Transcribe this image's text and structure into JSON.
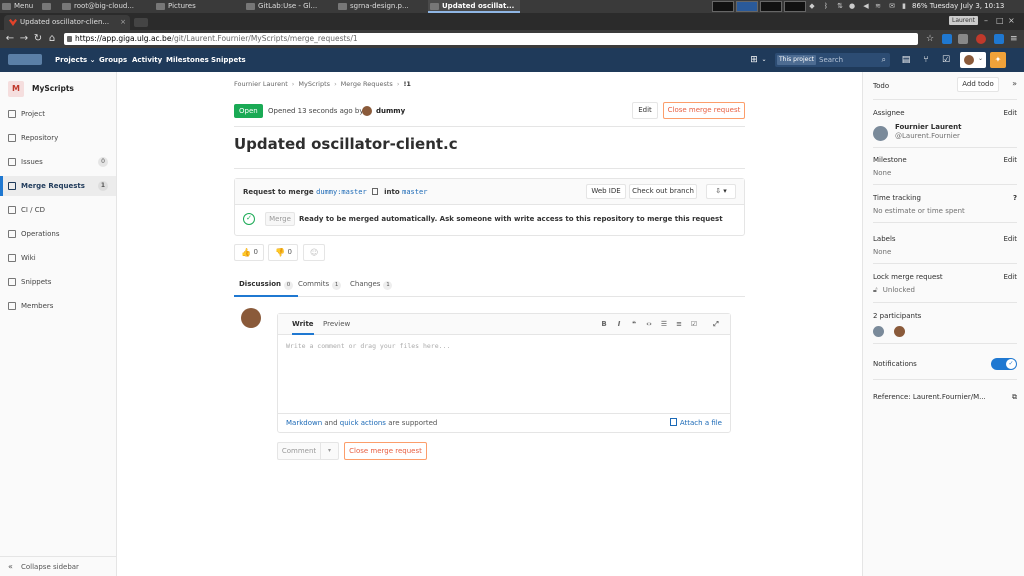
{
  "taskbar": {
    "items": [
      {
        "label": "Menu"
      },
      {
        "label": "root@big-cloud..."
      },
      {
        "label": "Pictures"
      },
      {
        "label": "GitLab:Use - Gl..."
      },
      {
        "label": "sgrna-design.p..."
      },
      {
        "label": "Updated oscillat..."
      }
    ],
    "battery": "86%",
    "datetime": "Tuesday July  3, 10:13"
  },
  "browser": {
    "tab_title": "Updated oscillator-clien...",
    "tab_close": "×",
    "window_badge": "Laurent",
    "url_host": "https://app.giga.ulg.ac.be",
    "url_path": "/git/Laurent.Fournier/MyScripts/merge_requests/1"
  },
  "header": {
    "nav": [
      "Projects",
      "Groups",
      "Activity",
      "Milestones",
      "Snippets"
    ],
    "search_scope": "This project",
    "search_placeholder": "Search"
  },
  "sidebar": {
    "project_initial": "M",
    "project_name": "MyScripts",
    "items": [
      {
        "label": "Project"
      },
      {
        "label": "Repository"
      },
      {
        "label": "Issues",
        "count": "0"
      },
      {
        "label": "Merge Requests",
        "count": "1"
      },
      {
        "label": "CI / CD"
      },
      {
        "label": "Operations"
      },
      {
        "label": "Wiki"
      },
      {
        "label": "Snippets"
      },
      {
        "label": "Members"
      }
    ],
    "collapse_label": "Collapse sidebar"
  },
  "breadcrumb": [
    "Fournier Laurent",
    "MyScripts",
    "Merge Requests",
    "!1"
  ],
  "mr": {
    "status": "Open",
    "opened_text": "Opened 13 seconds ago by",
    "author": "dummy",
    "edit_label": "Edit",
    "close_label": "Close merge request",
    "title": "Updated oscillator-client.c",
    "request_prefix": "Request to merge",
    "source_branch": "dummy:master",
    "into": "into",
    "target_branch": "master",
    "web_ide": "Web IDE",
    "checkout": "Check out branch",
    "merge_btn": "Merge",
    "merge_msg": "Ready to be merged automatically. Ask someone with write access to this repository to merge this request",
    "thumbs_up": "0",
    "thumbs_down": "0"
  },
  "tabs": [
    {
      "label": "Discussion",
      "count": "0"
    },
    {
      "label": "Commits",
      "count": "1"
    },
    {
      "label": "Changes",
      "count": "1"
    }
  ],
  "note": {
    "write_tab": "Write",
    "preview_tab": "Preview",
    "placeholder": "Write a comment or drag your files here...",
    "markdown": "Markdown",
    "and": "and",
    "quick_actions": "quick actions",
    "supported": "are supported",
    "attach": "Attach a file",
    "comment_btn": "Comment",
    "close_btn": "Close merge request"
  },
  "right_sidebar": {
    "todo_label": "Todo",
    "add_todo": "Add todo",
    "assignee_label": "Assignee",
    "assignee_name": "Fournier Laurent",
    "assignee_handle": "@Laurent.Fournier",
    "milestone_label": "Milestone",
    "milestone_value": "None",
    "time_label": "Time tracking",
    "time_value": "No estimate or time spent",
    "labels_label": "Labels",
    "labels_value": "None",
    "lock_label": "Lock merge request",
    "lock_value": "Unlocked",
    "participants_label": "2 participants",
    "notifications_label": "Notifications",
    "notifications_on": true,
    "reference": "Reference: Laurent.Fournier/M...",
    "edit_label": "Edit"
  },
  "colors": {
    "header_bg": "#1f3a5a",
    "open_green": "#1aaa55",
    "close_orange": "#e75e40",
    "link_blue": "#1b69b6",
    "active_blue": "#1f78d1"
  }
}
